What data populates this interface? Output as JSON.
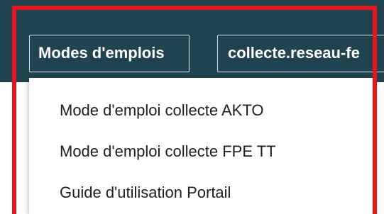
{
  "header": {
    "modes_button_label": "Modes d'emplois",
    "collecte_button_label": "collecte.reseau-fe"
  },
  "dropdown": {
    "items": [
      {
        "label": "Mode d'emploi collecte AKTO"
      },
      {
        "label": "Mode d'emploi collecte FPE TT"
      },
      {
        "label": "Guide d'utilisation Portail"
      }
    ]
  },
  "colors": {
    "header_bg": "#1f4450",
    "highlight_frame": "#e8141d",
    "menu_bg": "#ffffff",
    "menu_text": "#1f1f1f"
  }
}
